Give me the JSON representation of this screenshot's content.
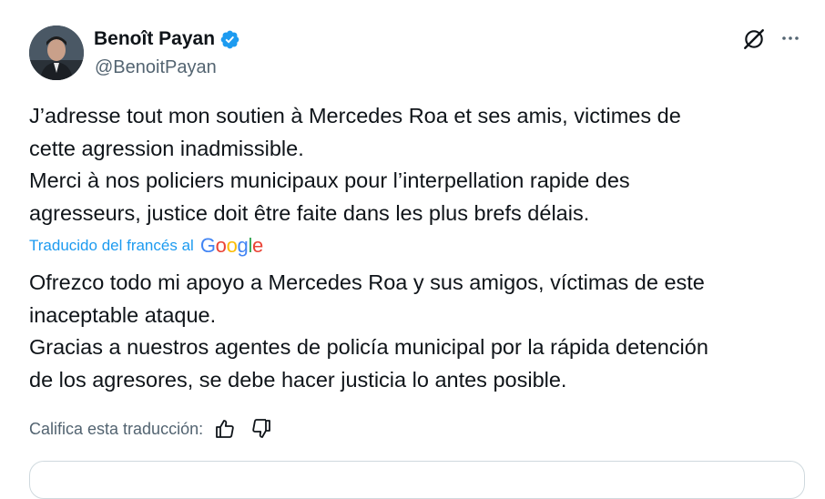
{
  "author": {
    "name": "Benoît Payan",
    "handle": "@BenoitPayan",
    "avatar_icon": "person-avatar",
    "verified_color": "#1d9bf0"
  },
  "actions": {
    "grok_icon": "grok-icon",
    "more_icon": "more-horizontal-icon"
  },
  "tweet": {
    "original_text": "J’adresse tout mon soutien à Mercedes Roa et ses amis, victimes de\ncette agression inadmissible.\nMerci à nos policiers municipaux pour l’interpellation rapide des\nagresseurs, justice doit être faite dans les plus brefs délais.",
    "translated_by_label": "Traducido del francés al",
    "translation_provider": "Google",
    "translated_text": "Ofrezco todo mi apoyo a Mercedes Roa y sus amigos, víctimas de este\ninaceptable ataque.\nGracias a nuestros agentes de policía municipal por la rápida detención\nde los agresores, se debe hacer justicia lo antes posible."
  },
  "rating": {
    "label": "Califica esta traducción:",
    "thumbs_up_icon": "thumbs-up-icon",
    "thumbs_down_icon": "thumbs-down-icon"
  },
  "colors": {
    "link": "#1d9bf0",
    "secondary_text": "#536471",
    "primary_text": "#0f1419"
  }
}
